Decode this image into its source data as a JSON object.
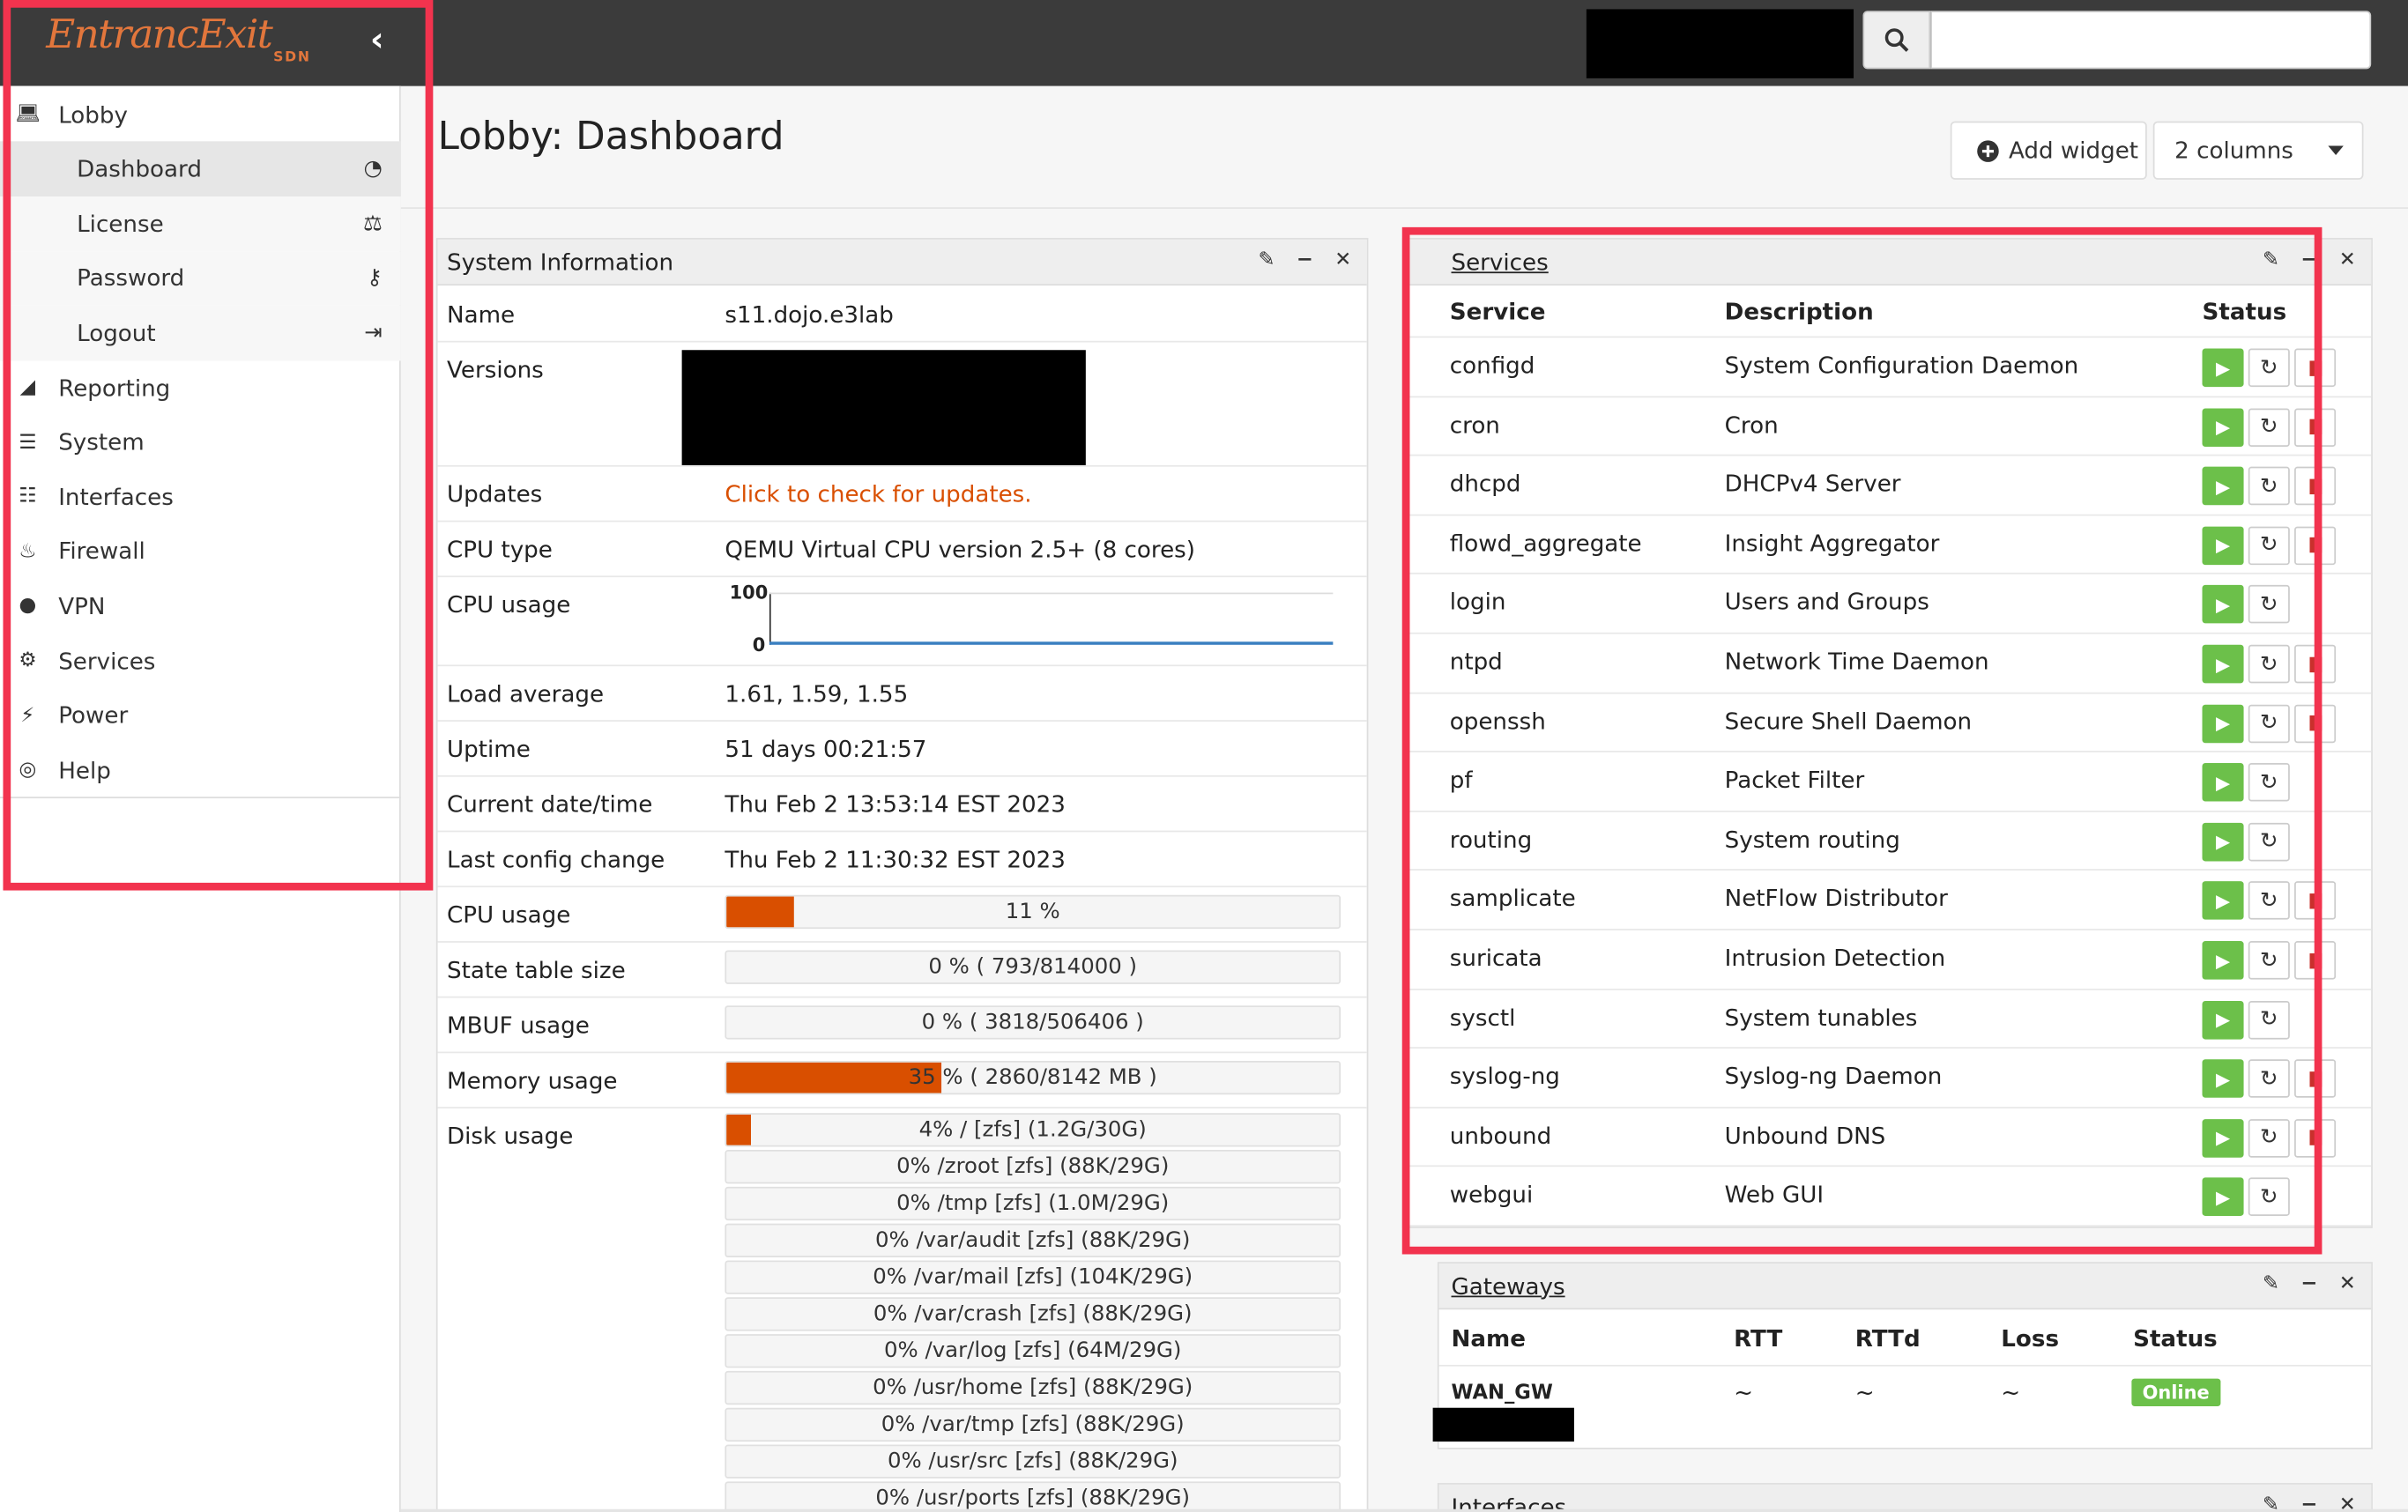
{
  "brand": {
    "logo_text": "EntrancExit",
    "logo_sub": "SDN"
  },
  "topbar": {
    "collapse_icon": "chevron-left-icon",
    "search_icon": "search-icon",
    "search_placeholder": ""
  },
  "sidebar": {
    "items": [
      {
        "label": "Lobby",
        "icon": "laptop-icon"
      },
      {
        "label": "Dashboard",
        "icon": "dashboard-icon",
        "sub": true,
        "active": true
      },
      {
        "label": "License",
        "icon": "balance-scale-icon",
        "sub": true
      },
      {
        "label": "Password",
        "icon": "key-icon",
        "sub": true
      },
      {
        "label": "Logout",
        "icon": "sign-out-icon",
        "sub": true
      },
      {
        "label": "Reporting",
        "icon": "area-chart-icon"
      },
      {
        "label": "System",
        "icon": "server-icon"
      },
      {
        "label": "Interfaces",
        "icon": "sitemap-icon"
      },
      {
        "label": "Firewall",
        "icon": "fire-icon"
      },
      {
        "label": "VPN",
        "icon": "globe-icon"
      },
      {
        "label": "Services",
        "icon": "cog-icon"
      },
      {
        "label": "Power",
        "icon": "plug-icon"
      },
      {
        "label": "Help",
        "icon": "life-ring-icon"
      }
    ]
  },
  "header": {
    "title": "Lobby: Dashboard",
    "add_widget": "Add widget",
    "columns": "2 columns"
  },
  "system_info": {
    "title": "System Information",
    "name_label": "Name",
    "name_value": "s11.dojo.e3lab",
    "versions_label": "Versions",
    "updates_label": "Updates",
    "updates_value": "Click to check for updates.",
    "cputype_label": "CPU type",
    "cputype_value": "QEMU Virtual CPU version 2.5+ (8 cores)",
    "cpugraph_label": "CPU usage",
    "cpugraph_max": "100",
    "cpugraph_min": "0",
    "load_label": "Load average",
    "load_value": "1.61, 1.59, 1.55",
    "uptime_label": "Uptime",
    "uptime_value": "51 days 00:21:57",
    "date_label": "Current date/time",
    "date_value": "Thu Feb 2 13:53:14 EST 2023",
    "config_label": "Last config change",
    "config_value": "Thu Feb 2 11:30:32 EST 2023",
    "cpu_label": "CPU usage",
    "cpu_text": "11 %",
    "cpu_fraction": 0.11,
    "state_label": "State table size",
    "state_text": "0 % ( 793/814000 )",
    "state_fraction": 0.0,
    "mbuf_label": "MBUF usage",
    "mbuf_text": "0 % ( 3818/506406 )",
    "mbuf_fraction": 0.0,
    "mem_label": "Memory usage",
    "mem_text": "35 % ( 2860/8142 MB )",
    "mem_fraction": 0.35,
    "disk_label": "Disk usage",
    "disks": [
      {
        "text": "4% / [zfs] (1.2G/30G)",
        "fraction": 0.04
      },
      {
        "text": "0% /zroot [zfs] (88K/29G)",
        "fraction": 0
      },
      {
        "text": "0% /tmp [zfs] (1.0M/29G)",
        "fraction": 0
      },
      {
        "text": "0% /var/audit [zfs] (88K/29G)",
        "fraction": 0
      },
      {
        "text": "0% /var/mail [zfs] (104K/29G)",
        "fraction": 0
      },
      {
        "text": "0% /var/crash [zfs] (88K/29G)",
        "fraction": 0
      },
      {
        "text": "0% /var/log [zfs] (64M/29G)",
        "fraction": 0
      },
      {
        "text": "0% /usr/home [zfs] (88K/29G)",
        "fraction": 0
      },
      {
        "text": "0% /var/tmp [zfs] (88K/29G)",
        "fraction": 0
      },
      {
        "text": "0% /usr/src [zfs] (88K/29G)",
        "fraction": 0
      },
      {
        "text": "0% /usr/ports [zfs] (88K/29G)",
        "fraction": 0
      }
    ]
  },
  "services": {
    "title": "Services",
    "col_service": "Service",
    "col_description": "Description",
    "col_status": "Status",
    "rows": [
      {
        "name": "configd",
        "desc": "System Configuration Daemon",
        "stop": true
      },
      {
        "name": "cron",
        "desc": "Cron",
        "stop": true
      },
      {
        "name": "dhcpd",
        "desc": "DHCPv4 Server",
        "stop": true
      },
      {
        "name": "flowd_aggregate",
        "desc": "Insight Aggregator",
        "stop": true
      },
      {
        "name": "login",
        "desc": "Users and Groups",
        "stop": false
      },
      {
        "name": "ntpd",
        "desc": "Network Time Daemon",
        "stop": true
      },
      {
        "name": "openssh",
        "desc": "Secure Shell Daemon",
        "stop": true
      },
      {
        "name": "pf",
        "desc": "Packet Filter",
        "stop": false
      },
      {
        "name": "routing",
        "desc": "System routing",
        "stop": false
      },
      {
        "name": "samplicate",
        "desc": "NetFlow Distributor",
        "stop": true
      },
      {
        "name": "suricata",
        "desc": "Intrusion Detection",
        "stop": true
      },
      {
        "name": "sysctl",
        "desc": "System tunables",
        "stop": false
      },
      {
        "name": "syslog-ng",
        "desc": "Syslog-ng Daemon",
        "stop": true
      },
      {
        "name": "unbound",
        "desc": "Unbound DNS",
        "stop": true
      },
      {
        "name": "webgui",
        "desc": "Web GUI",
        "stop": false
      }
    ]
  },
  "gateways": {
    "title": "Gateways",
    "col_name": "Name",
    "col_rtt": "RTT",
    "col_rttd": "RTTd",
    "col_loss": "Loss",
    "col_status": "Status",
    "row": {
      "name": "WAN_GW",
      "rtt": "~",
      "rttd": "~",
      "loss": "~",
      "status": "Online"
    }
  },
  "interfaces_widget": {
    "title": "Interfaces"
  },
  "colors": {
    "accent": "#d94f00",
    "highlight": "#f2334e",
    "play": "#6cc04a",
    "topbar": "#3b3b3b"
  }
}
